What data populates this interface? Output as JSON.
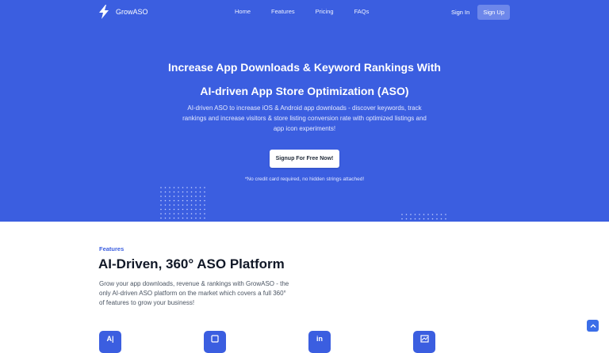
{
  "header": {
    "brand": "GrowASO",
    "nav": [
      "Home",
      "Features",
      "Pricing",
      "FAQs"
    ],
    "signin_label": "Sign In",
    "signup_label": "Sign Up"
  },
  "hero": {
    "title_line1": "Increase App Downloads & Keyword Rankings With",
    "title_line2": "AI-driven App Store Optimization (ASO)",
    "description": "AI-driven ASO to increase iOS & Android app downloads - discover keywords, track rankings and increase visitors & store listing conversion rate with optimized listings and app icon experiments!",
    "cta_label": "Signup For Free Now!",
    "note": "*No credit card required, no hidden strings attached!"
  },
  "features": {
    "label": "Features",
    "title": "AI-Driven, 360° ASO Platform",
    "description": "Grow your app downloads, revenue & rankings with GrowASO - the only AI-driven ASO platform on the market which covers a full 360° of features to grow your business!",
    "icons": [
      "ai-icon",
      "listing-icon",
      "linkedin-style-icon",
      "chart-icon"
    ]
  },
  "colors": {
    "hero_bg": "#3b5ee0",
    "accent": "#3b5ee0"
  },
  "icons": {
    "logo": "lightning-bolt-icon",
    "scroll_top": "chevron-up-icon"
  }
}
